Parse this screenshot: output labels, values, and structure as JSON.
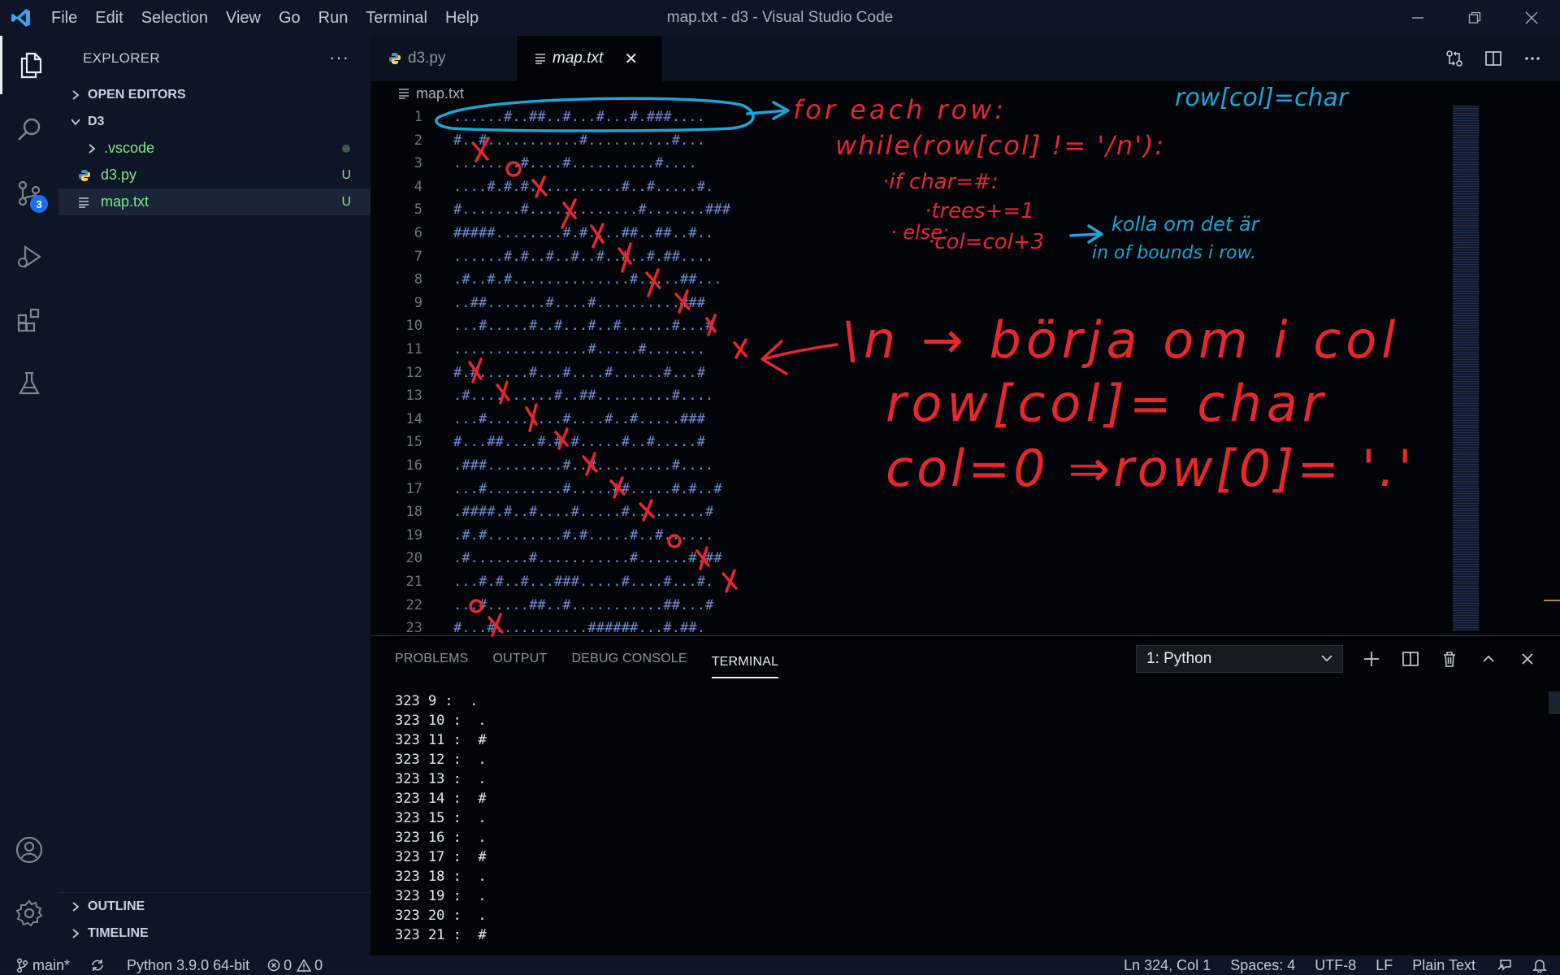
{
  "window": {
    "title": "map.txt - d3 - Visual Studio Code"
  },
  "menu": [
    "File",
    "Edit",
    "Selection",
    "View",
    "Go",
    "Run",
    "Terminal",
    "Help"
  ],
  "activity": {
    "scm_badge": "3"
  },
  "sidebar": {
    "title": "EXPLORER",
    "more": "···",
    "open_editors": "OPEN EDITORS",
    "folder": "D3",
    "items": [
      {
        "label": ".vscode",
        "flag": ""
      },
      {
        "label": "d3.py",
        "flag": "U"
      },
      {
        "label": "map.txt",
        "flag": "U"
      }
    ],
    "outline": "OUTLINE",
    "timeline": "TIMELINE"
  },
  "tabs": [
    {
      "label": "d3.py"
    },
    {
      "label": "map.txt",
      "close": "✕"
    }
  ],
  "breadcrumb": "map.txt",
  "code_lines": [
    {
      "n": "1",
      "text": "......#..##..#...#...#.###...."
    },
    {
      "n": "2",
      "text": "#..#...........#..........#..."
    },
    {
      "n": "3",
      "text": "........#....#..........#...."
    },
    {
      "n": "4",
      "text": "....#.#.#...........#..#.....#."
    },
    {
      "n": "5",
      "text": "#.......#.............#.......###"
    },
    {
      "n": "6",
      "text": "#####........#.#....##..##..#.."
    },
    {
      "n": "7",
      "text": "......#.#..#..#..#..#..#.##...."
    },
    {
      "n": "8",
      "text": ".#..#.#..............#.....##..."
    },
    {
      "n": "9",
      "text": "..##.......#....#..........###"
    },
    {
      "n": "10",
      "text": "...#.....#..#...#..#......#...#"
    },
    {
      "n": "11",
      "text": "................#.....#......."
    },
    {
      "n": "12",
      "text": "#.#......#...#....#......#...#"
    },
    {
      "n": "13",
      "text": ".#..........#..##.........#...."
    },
    {
      "n": "14",
      "text": "...#.........#....#..#.....###"
    },
    {
      "n": "15",
      "text": "#...##....#.#.#.....#..#.....#"
    },
    {
      "n": "16",
      "text": ".###.........#..#.........#...."
    },
    {
      "n": "17",
      "text": "...#.........#.....##.....#.#..#"
    },
    {
      "n": "18",
      "text": ".####.#..#....#.....#.........#"
    },
    {
      "n": "19",
      "text": ".#.#.........#.#.....#..#......"
    },
    {
      "n": "20",
      "text": ".#.......#...........#......#.##"
    },
    {
      "n": "21",
      "text": "...#.#..#...###.....#....#...#."
    },
    {
      "n": "22",
      "text": "...#.....##..#...........##...#"
    },
    {
      "n": "23",
      "text": "#...#...........######...#.##."
    }
  ],
  "panel": {
    "tabs": [
      "PROBLEMS",
      "OUTPUT",
      "DEBUG CONSOLE",
      "TERMINAL"
    ],
    "terminal_select": "1: Python",
    "terminal_lines": [
      "323 9 :  .",
      "323 10 :  .",
      "323 11 :  #",
      "323 12 :  .",
      "323 13 :  .",
      "323 14 :  #",
      "323 15 :  .",
      "323 16 :  .",
      "323 17 :  #",
      "323 18 :  .",
      "323 19 :  .",
      "323 20 :  .",
      "323 21 :  #"
    ]
  },
  "status": {
    "branch": "main*",
    "python": "Python 3.9.0 64-bit",
    "errors": "0",
    "warnings": "0",
    "position": "Ln 324, Col 1",
    "spaces": "Spaces: 4",
    "encoding": "UTF-8",
    "eol": "LF",
    "language": "Plain Text"
  },
  "annotations": {
    "cyan_top": "row[col]=char",
    "red_1": "for each row:",
    "red_2": "while(row[col] != '/n'):",
    "red_3": "·if char=#:",
    "red_4": "·trees+=1",
    "red_5": "· else:",
    "red_6": "·col=col+3",
    "cyan_note_1": "kolla om det är",
    "cyan_note_2": "in of bounds i row.",
    "big_1": "\\n → börja om i col",
    "big_2": "row[col]= char",
    "big_3": "col=0 ⇒row[0]= '.'",
    "ink_red": "#e8262b",
    "ink_cyan": "#19a6d6"
  }
}
